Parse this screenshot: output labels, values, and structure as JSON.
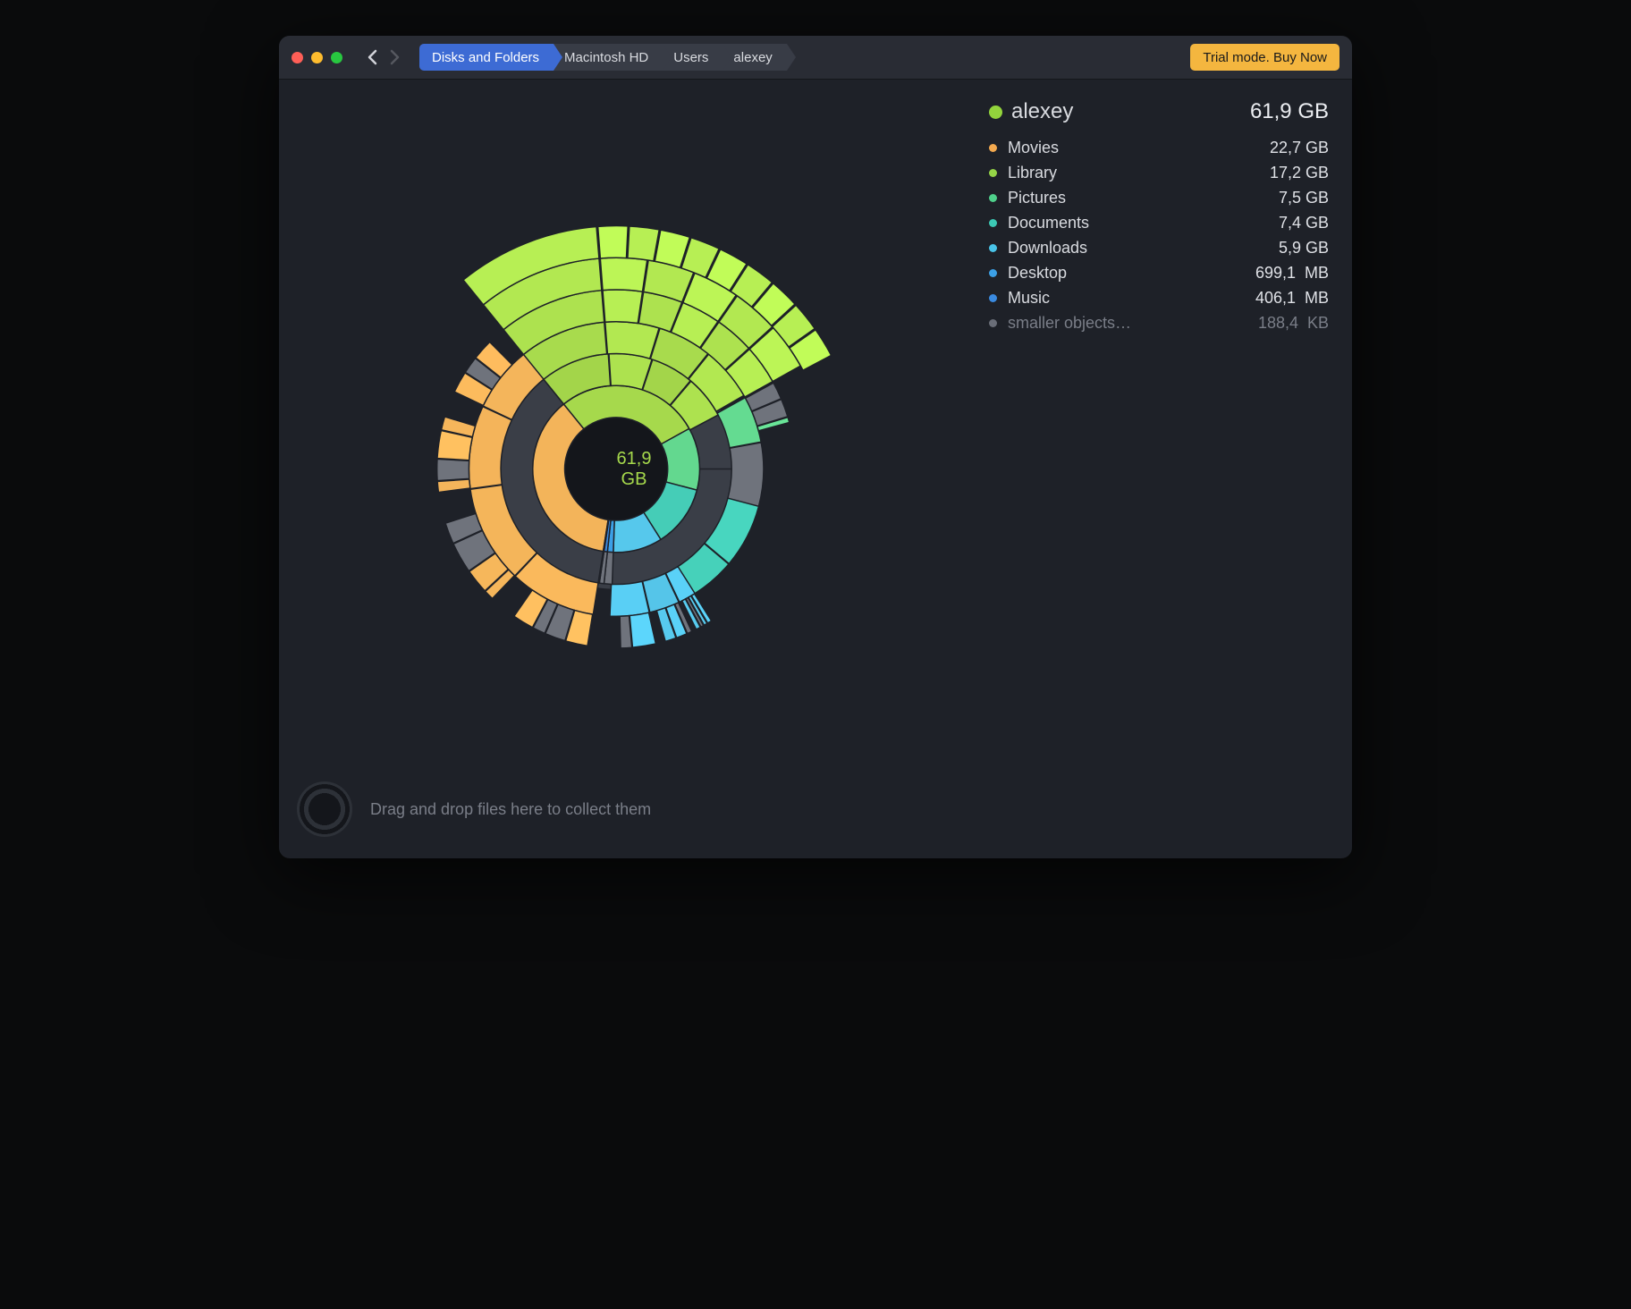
{
  "toolbar": {
    "breadcrumbs": [
      "Disks and Folders",
      "Macintosh HD",
      "Users",
      "alexey"
    ],
    "active_crumb_index": 0,
    "buy_label": "Trial mode. Buy Now"
  },
  "colors": {
    "traffic": [
      "#ff5f57",
      "#febc2e",
      "#28c840"
    ]
  },
  "current": {
    "name": "alexey",
    "size": "61,9 GB",
    "dot_color": "#93d43c"
  },
  "items": [
    {
      "name": "Movies",
      "size": "22,7 GB",
      "color": "#f3a94f"
    },
    {
      "name": "Library",
      "size": "17,2 GB",
      "color": "#95d547"
    },
    {
      "name": "Pictures",
      "size": "7,5 GB",
      "color": "#4fd08b"
    },
    {
      "name": "Documents",
      "size": "7,4 GB",
      "color": "#3cc9b5"
    },
    {
      "name": "Downloads",
      "size": "5,9 GB",
      "color": "#49c3e8"
    },
    {
      "name": "Desktop",
      "size": "699,1  MB",
      "color": "#3ca0e6"
    },
    {
      "name": "Music",
      "size": "406,1  MB",
      "color": "#3a8ae0"
    },
    {
      "name": "smaller objects…",
      "size": "188,4  KB",
      "color": "#6a6e78",
      "small": true
    }
  ],
  "footer": {
    "hint": "Drag and drop files here to collect them"
  },
  "chart_data": {
    "type": "sunburst",
    "center_label": "61,9\nGB",
    "total_gb": 61.9,
    "ring1": [
      {
        "name": "Movies",
        "gb": 22.7,
        "color": "#f3b45a"
      },
      {
        "name": "Library",
        "gb": 17.2,
        "color": "#a6d94c"
      },
      {
        "name": "Pictures",
        "gb": 7.5,
        "color": "#63d88f"
      },
      {
        "name": "Documents",
        "gb": 7.4,
        "color": "#45cdb7"
      },
      {
        "name": "Downloads",
        "gb": 5.9,
        "color": "#56c8ec"
      },
      {
        "name": "Desktop",
        "gb": 0.7,
        "color": "#3ca0e6"
      },
      {
        "name": "Music",
        "gb": 0.4,
        "color": "#3a8ae0"
      },
      {
        "name": "other",
        "gb": 0.1,
        "color": "#6f737c"
      }
    ],
    "rings_depth": 6,
    "deep_branch": "Library",
    "grey_fill": "#6f737c"
  }
}
